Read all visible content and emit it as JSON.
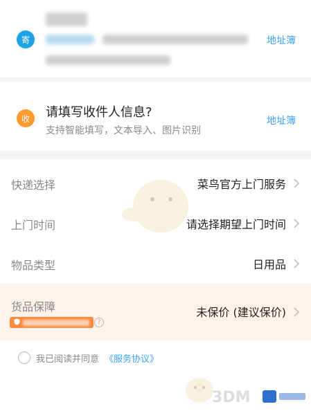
{
  "sender": {
    "badge_label": "寄",
    "address_book_label": "地址簿"
  },
  "receiver": {
    "badge_label": "收",
    "title": "请填写收件人信息?",
    "subtitle": "支持智能填写，文本导入、图片识别",
    "address_book_label": "地址簿"
  },
  "form": {
    "rows": [
      {
        "label": "快递选择",
        "value": "菜鸟官方上门服务"
      },
      {
        "label": "上门时间",
        "value": "请选择期望上门时间"
      },
      {
        "label": "物品类型",
        "value": "日用品"
      }
    ],
    "insurance": {
      "label": "货品保障",
      "value": "未保价 (建议保价)"
    }
  },
  "agreement": {
    "text": "我已阅读并同意",
    "link": "《服务协议》"
  },
  "colors": {
    "accent_blue": "#3aa0ff",
    "sender_badge": "#1fa3e8",
    "receiver_badge": "#ff9a2e",
    "insurance_bg": "#fff3ea",
    "guarantee_pill": "#ff8a3d"
  },
  "icons": {
    "chevron": "chevron-right-icon",
    "info": "info-icon",
    "shield": "shield-icon"
  }
}
